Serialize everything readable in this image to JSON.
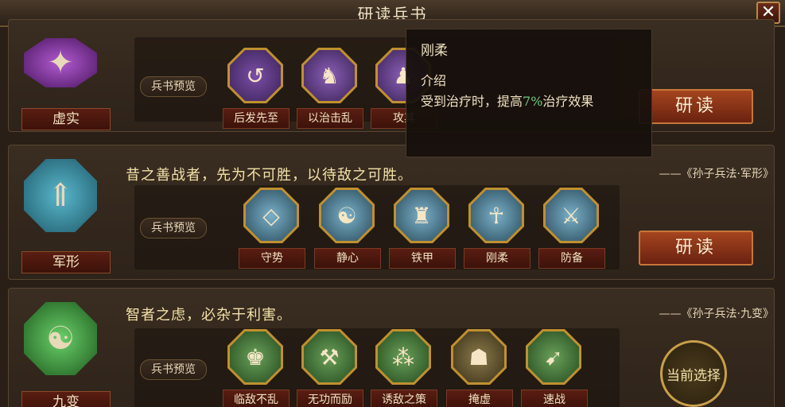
{
  "window": {
    "title": "研读兵书",
    "close_label": "✕"
  },
  "books": [
    {
      "name": "虚实",
      "quote": "",
      "source": "",
      "preview_label": "兵书预览",
      "skills": [
        "后发先至",
        "以治击乱",
        "攻其"
      ],
      "action": "研读",
      "emblem_color": "#7a2fa0",
      "emblem_icon": "spiked-star-icon"
    },
    {
      "name": "军形",
      "quote": "昔之善战者，先为不可胜，以待敌之可胜。",
      "source": "——《孙子兵法·军形》",
      "preview_label": "兵书预览",
      "skills": [
        "守势",
        "静心",
        "铁甲",
        "刚柔",
        "防备"
      ],
      "action": "研读",
      "emblem_color": "#2f8aa0",
      "emblem_icon": "shield-arrow-icon"
    },
    {
      "name": "九变",
      "quote": "智者之虑，必杂于利害。",
      "source": "——《孙子兵法·九变》",
      "preview_label": "兵书预览",
      "skills": [
        "临敌不乱",
        "无功而励",
        "诱敌之策",
        "掩虚",
        "速战"
      ],
      "action": "当前选择",
      "emblem_color": "#3a9a3a",
      "emblem_icon": "yin-yang-icon"
    }
  ],
  "tooltip": {
    "name": "刚柔",
    "heading": "介绍",
    "desc_before": "受到治疗时，提高",
    "desc_highlight": "7%",
    "desc_after": "治疗效果",
    "highlight_color": "#6fd07a"
  }
}
